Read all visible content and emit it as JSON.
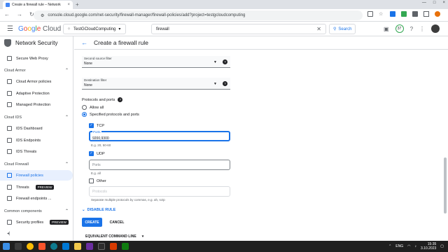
{
  "browser": {
    "tab_title": "Create a firewall rule – Network",
    "tab_close": "×",
    "new_tab": "+",
    "url": "console.cloud.google.com/net-security/firewall-manager/firewall-policies/add?project=testgcloudcomputing",
    "window_controls": [
      "—",
      "□",
      "×"
    ]
  },
  "header": {
    "logo_google": [
      "G",
      "o",
      "o",
      "g",
      "l",
      "e"
    ],
    "logo_cloud": "Cloud",
    "project": "TestGCloudComputing",
    "search_value": "firewall",
    "search_button": "Search",
    "notification_count": "37"
  },
  "sidebar": {
    "title": "Network Security",
    "item_secure_web_proxy": "Secure Web Proxy",
    "section_cloud_armor": "Cloud Armor",
    "item_cloud_armor_policies": "Cloud Armor policies",
    "item_adaptive_protection": "Adaptive Protection",
    "item_managed_protection": "Managed Protection",
    "section_cloud_ids": "Cloud IDS",
    "item_ids_dashboard": "IDS Dashboard",
    "item_ids_endpoints": "IDS Endpoints",
    "item_ids_threats": "IDS Threats",
    "section_cloud_firewall": "Cloud Firewall",
    "item_firewall_policies": "Firewall policies",
    "item_threats": "Threats",
    "item_firewall_endpoints": "Firewall endpoints ...",
    "section_common_components": "Common components",
    "item_security_profiles": "Security profiles",
    "preview_badge": "PREVIEW",
    "collapse": "◂|"
  },
  "page": {
    "title": "Create a firewall rule",
    "second_source_filter_label": "Second source filter",
    "second_source_filter_value": "None",
    "destination_filter_label": "Destination filter",
    "destination_filter_value": "None",
    "protocols_label": "Protocols and ports",
    "allow_all": "Allow all",
    "specified": "Specified protocols and ports",
    "tcp_label": "TCP",
    "tcp_ports_label": "Ports",
    "tcp_ports_value": "9200,9300",
    "tcp_hint": "E.g. 20, 50-60",
    "udp_label": "UDP",
    "udp_ports_placeholder": "Ports",
    "udp_hint": "E.g. all",
    "other_label": "Other",
    "other_placeholder": "Protocols",
    "other_hint": "Separate multiple protocols by commas, e.g. ah, sctp",
    "disable_rule": "DISABLE RULE",
    "create": "CREATE",
    "cancel": "CANCEL",
    "equivalent_command_line": "EQUIVALENT COMMAND LINE"
  },
  "taskbar": {
    "lang": "ENG",
    "time": "15:35",
    "date": "3.10.2023"
  },
  "colors": {
    "accent": "#1a73e8",
    "active_bg": "#e8f0fe",
    "taskbar": "#1f1f1f"
  }
}
